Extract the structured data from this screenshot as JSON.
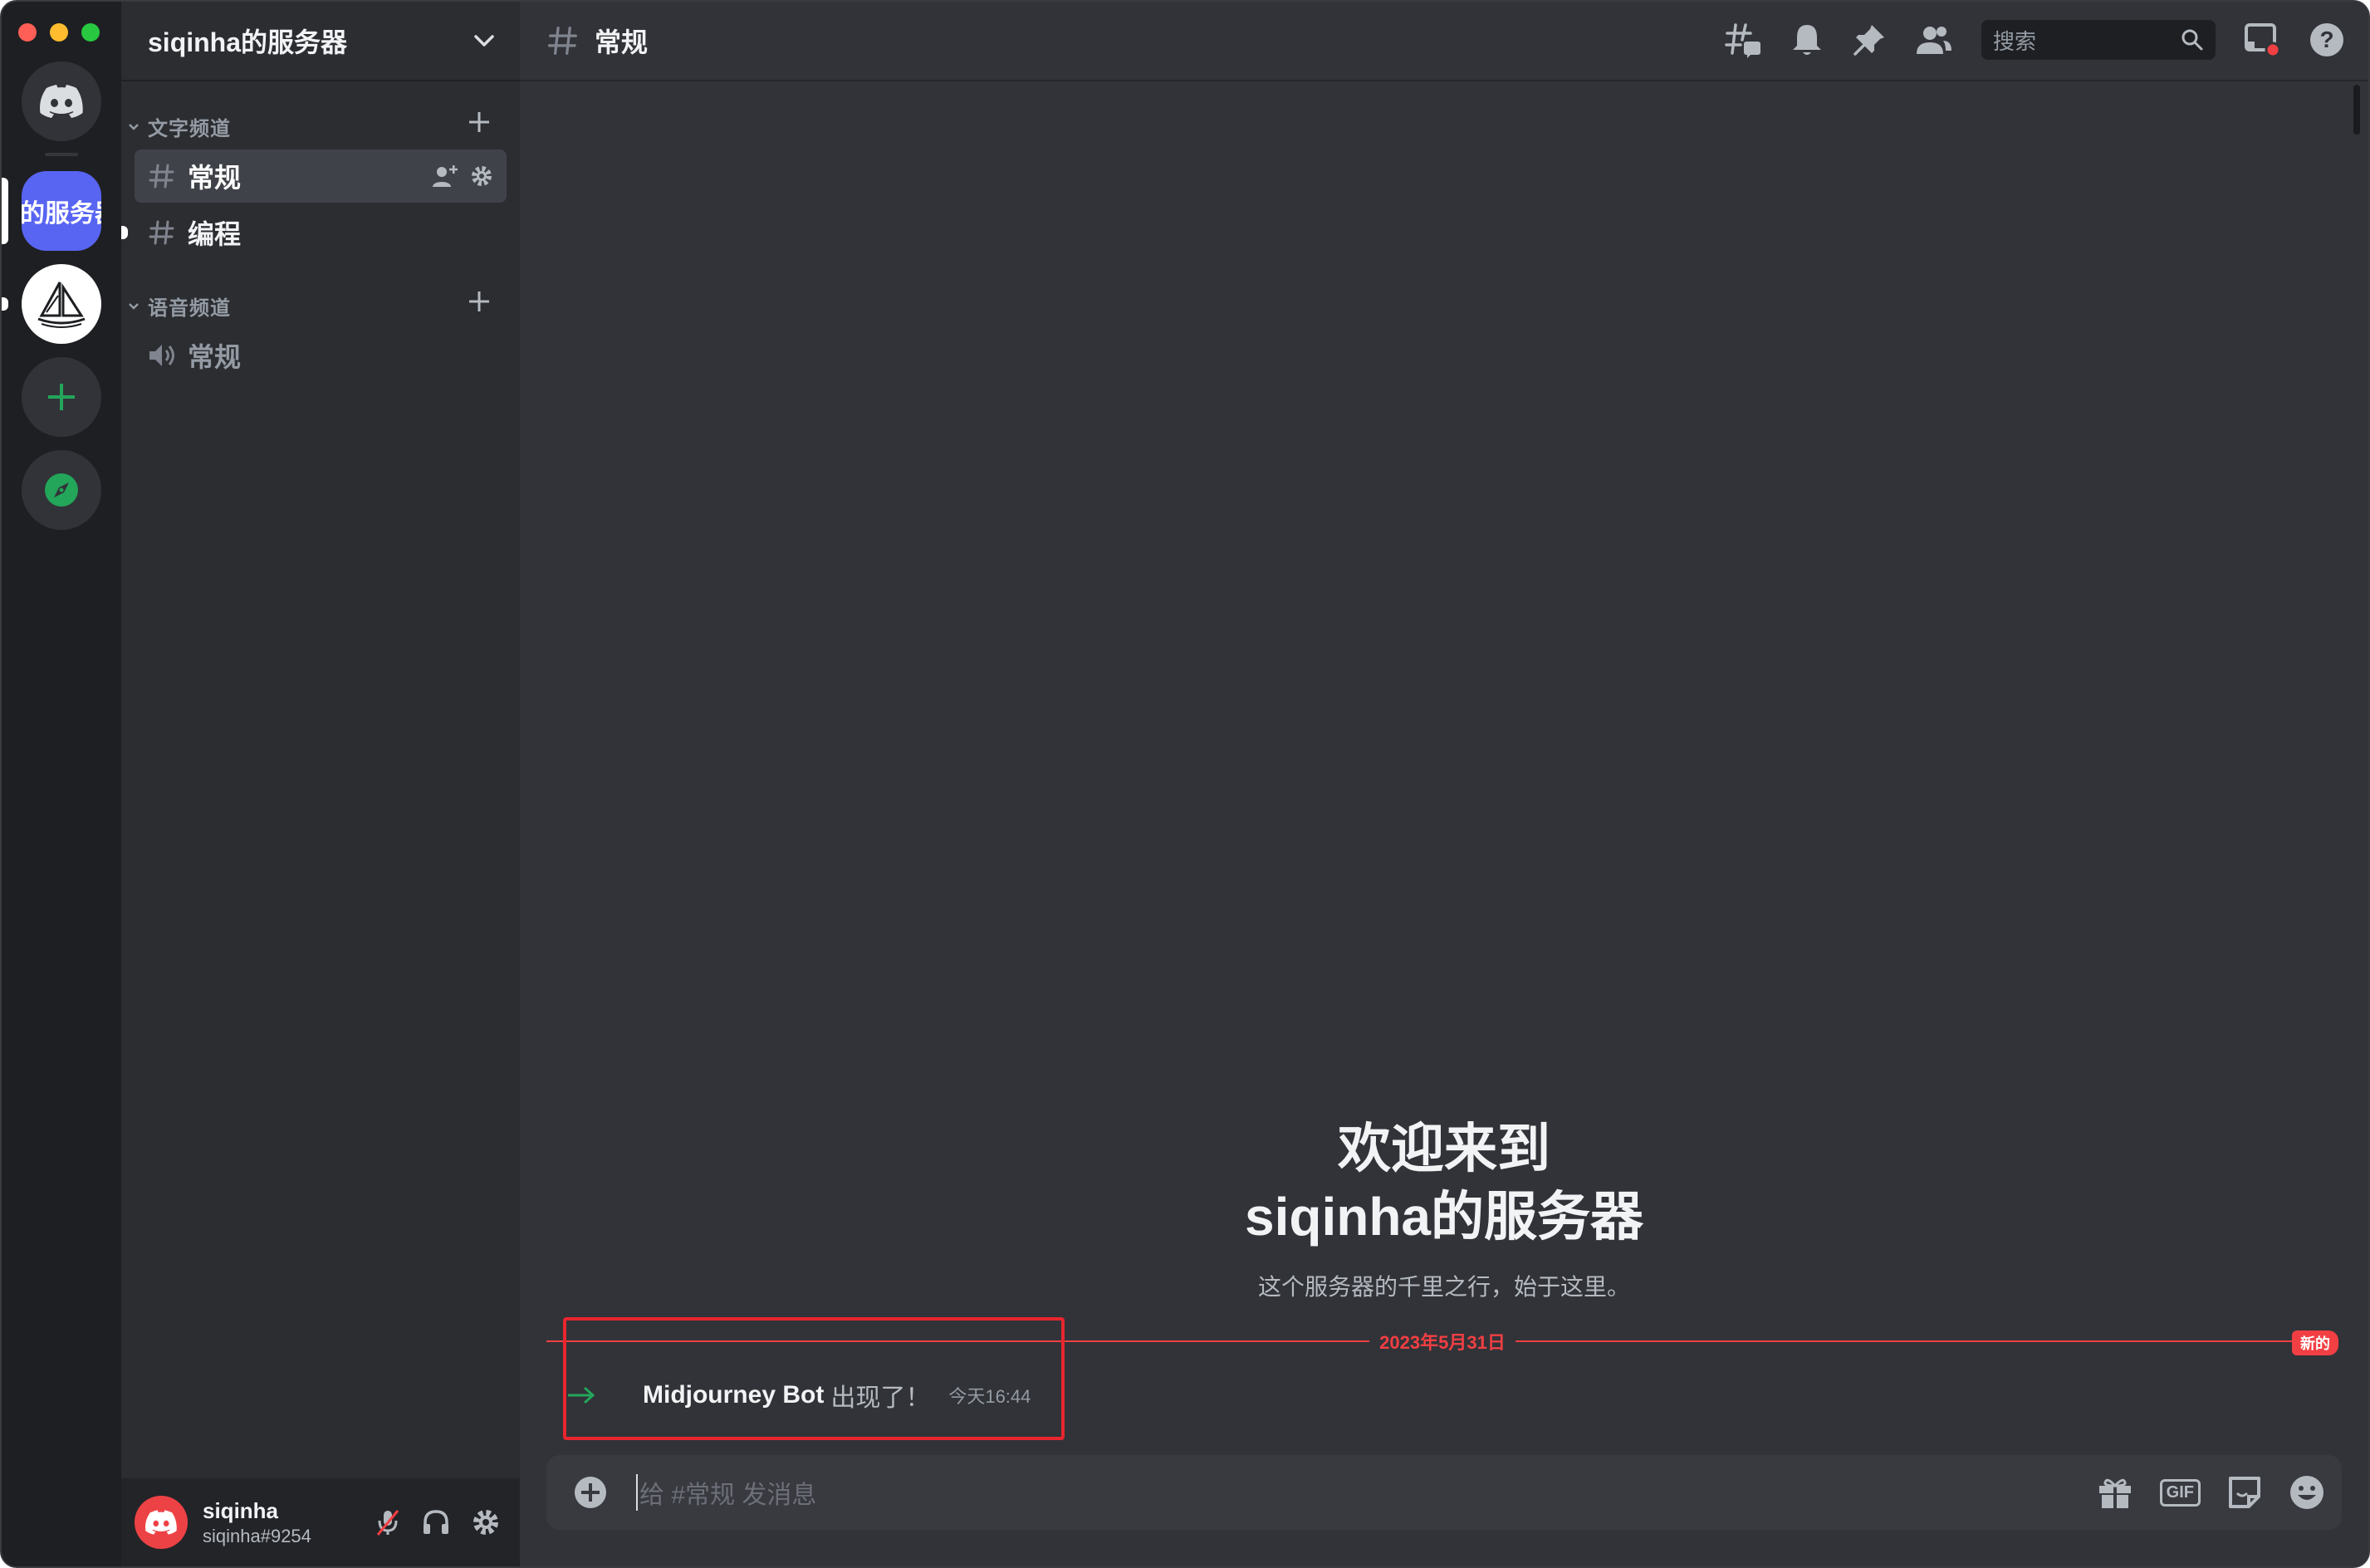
{
  "window_controls": [
    "close",
    "minimize",
    "zoom"
  ],
  "guilds": {
    "home_icon": "discord-logo-icon",
    "active_server_label": "的服务器",
    "midjourney_icon": "midjourney-sailboat-icon",
    "add_icon": "plus-icon",
    "explore_icon": "compass-icon"
  },
  "sidebar": {
    "server_name": "siqinha的服务器",
    "categories": [
      {
        "label": "文字频道",
        "channels": [
          {
            "name": "常规",
            "active": true
          },
          {
            "name": "编程",
            "active": false
          }
        ]
      },
      {
        "label": "语音频道",
        "channels": [
          {
            "name": "常规",
            "active": false
          }
        ]
      }
    ]
  },
  "user": {
    "name": "siqinha",
    "tag": "siqinha#9254",
    "controls": [
      "mic-muted-icon",
      "headphones-icon",
      "gear-icon"
    ]
  },
  "header": {
    "channel_name": "常规",
    "search_placeholder": "搜索",
    "icons": [
      "threads-icon",
      "bell-icon",
      "pin-icon",
      "members-icon",
      "search-icon",
      "inbox-icon",
      "help-icon"
    ]
  },
  "welcome": {
    "line1": "欢迎来到",
    "line2": "siqinha的服务器",
    "subtitle": "这个服务器的千里之行，始于这里。"
  },
  "divider": {
    "date": "2023年5月31日",
    "new_badge": "新的"
  },
  "message": {
    "author": "Midjourney Bot",
    "text": "出现了！",
    "time": "今天16:44"
  },
  "composer": {
    "placeholder": "给 #常规 发消息",
    "tools": [
      "gift-icon",
      "gif-button",
      "sticker-icon",
      "emoji-icon"
    ],
    "gif_label": "GIF"
  },
  "colors": {
    "accent": "#5865f2",
    "danger": "#f23f43",
    "success": "#23a55a",
    "background": "#313338",
    "sidebar": "#2b2d31",
    "rail": "#1e1f22"
  }
}
